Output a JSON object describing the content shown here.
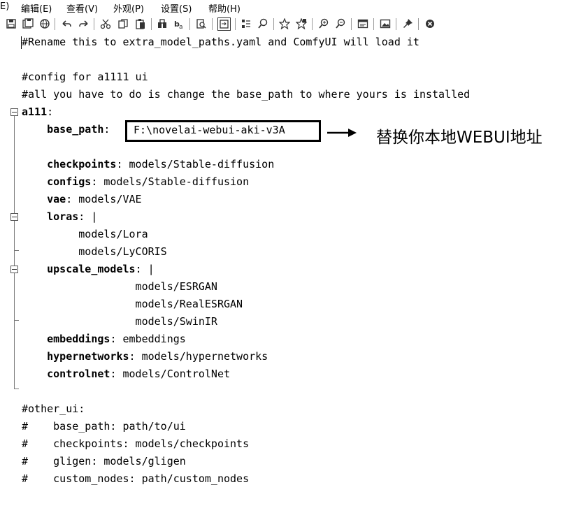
{
  "menu": [
    "E)",
    "编辑(E)",
    "查看(V)",
    "外观(P)",
    "设置(S)",
    "帮助(H)"
  ],
  "toolbar_icons": [
    "save-icon",
    "save-all-icon",
    "globe-icon",
    "undo-icon",
    "redo-icon",
    "cut-icon",
    "copy-icon",
    "paste-icon",
    "find-icon",
    "replace-icon",
    "find-in-files-icon",
    "wordwrap-icon",
    "indent-icon",
    "zoom-find-icon",
    "bookmark-icon",
    "bookmark-add-icon",
    "zoom-in-icon",
    "zoom-out-icon",
    "window-icon",
    "image-icon",
    "pin-icon",
    "close-circle-icon"
  ],
  "editor": {
    "lines": [
      {
        "text": "#Rename this to extra_model_paths.yaml and ComfyUI will load it"
      },
      {
        "text": ""
      },
      {
        "text": "#config for a1111 ui"
      },
      {
        "text": "#all you have to do is change the base_path to where yours is installed"
      },
      {
        "key": "a111",
        "rest": ":"
      },
      {
        "indent": "    ",
        "key": "base_path",
        "rest": ": "
      },
      {
        "text": ""
      },
      {
        "indent": "    ",
        "key": "checkpoints",
        "rest": ": models/Stable-diffusion"
      },
      {
        "indent": "    ",
        "key": "configs",
        "rest": ": models/Stable-diffusion"
      },
      {
        "indent": "    ",
        "key": "vae",
        "rest": ": models/VAE"
      },
      {
        "indent": "    ",
        "key": "loras",
        "rest": ": |"
      },
      {
        "text": "         models/Lora"
      },
      {
        "text": "         models/LyCORIS"
      },
      {
        "indent": "    ",
        "key": "upscale_models",
        "rest": ": |"
      },
      {
        "text": "                  models/ESRGAN"
      },
      {
        "text": "                  models/RealESRGAN"
      },
      {
        "text": "                  models/SwinIR"
      },
      {
        "indent": "    ",
        "key": "embeddings",
        "rest": ": embeddings"
      },
      {
        "indent": "    ",
        "key": "hypernetworks",
        "rest": ": models/hypernetworks"
      },
      {
        "indent": "    ",
        "key": "controlnet",
        "rest": ": models/ControlNet"
      },
      {
        "text": ""
      },
      {
        "text": "#other_ui:"
      },
      {
        "text": "#    base_path: path/to/ui"
      },
      {
        "text": "#    checkpoints: models/checkpoints"
      },
      {
        "text": "#    gligen: models/gligen"
      },
      {
        "text": "#    custom_nodes: path/custom_nodes"
      }
    ],
    "base_path_value": "F:\\novelai-webui-aki-v3A"
  },
  "annotation": {
    "text": "替换你本地WEBUI地址"
  }
}
